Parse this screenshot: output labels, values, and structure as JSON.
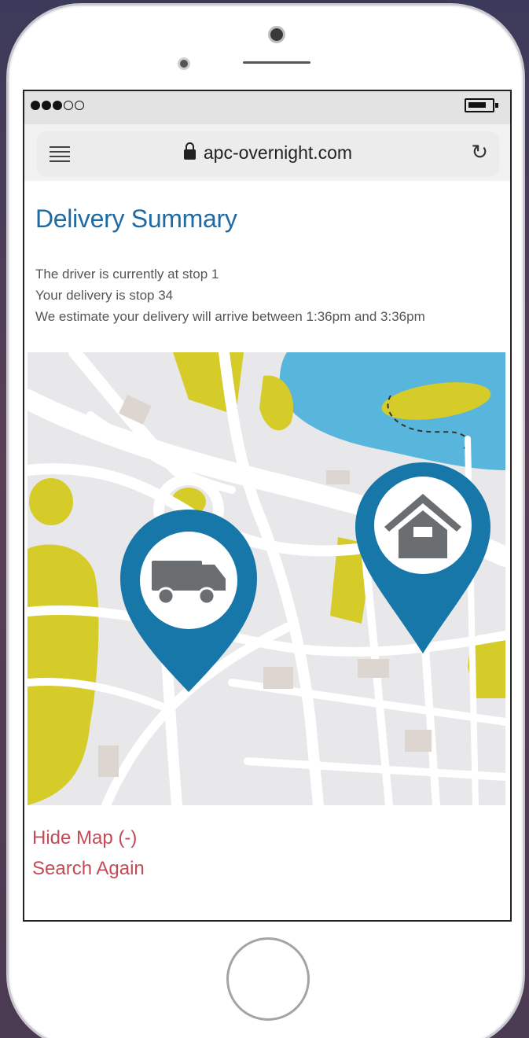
{
  "status_bar": {
    "signal_icon": "signal-dots-icon",
    "battery_icon": "battery-icon"
  },
  "browser": {
    "menu_icon": "hamburger-menu-icon",
    "lock_icon": "lock-icon",
    "url": "apc-overnight.com",
    "reload_icon": "reload-icon"
  },
  "page": {
    "title": "Delivery Summary",
    "lines": [
      "The driver is currently at stop 1",
      "Your delivery is stop 34",
      "We estimate your delivery will arrive between 1:36pm and 3:36pm"
    ],
    "map": {
      "driver_marker_icon": "delivery-truck-icon",
      "destination_marker_icon": "house-icon",
      "marker_color": "#1677a8",
      "park_color": "#d5cc2a",
      "water_color": "#58b6dc"
    },
    "links": {
      "hide_map": "Hide Map (-)",
      "search_again": "Search Again"
    },
    "link_color": "#c34b56",
    "title_color": "#1f6aa3"
  }
}
